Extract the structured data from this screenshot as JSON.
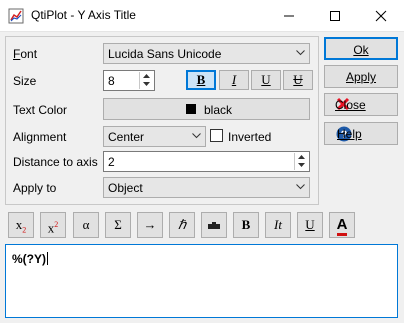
{
  "window": {
    "title": "QtiPlot - Y Axis Title",
    "controls": [
      "minimize-icon",
      "maximize-icon",
      "close-icon"
    ]
  },
  "form": {
    "font": {
      "label": "Font",
      "value": "Lucida Sans Unicode"
    },
    "size": {
      "label": "Size",
      "value": "8",
      "styles": [
        {
          "name": "bold",
          "glyph": "B",
          "active": true
        },
        {
          "name": "italic",
          "glyph": "I",
          "active": false
        },
        {
          "name": "underline",
          "glyph": "U",
          "active": false
        },
        {
          "name": "strikeout",
          "glyph": "U",
          "active": false
        }
      ]
    },
    "text_color": {
      "label": "Text Color",
      "value": "black",
      "swatch": "#000000"
    },
    "alignment": {
      "label": "Alignment",
      "value": "Center"
    },
    "inverted": {
      "label": "Inverted",
      "checked": false
    },
    "distance": {
      "label": "Distance to axis",
      "value": "2"
    },
    "apply_to": {
      "label": "Apply to",
      "value": "Object"
    }
  },
  "buttons": {
    "ok": "Ok",
    "apply": "Apply",
    "close": "Close",
    "help": "Help"
  },
  "toolbar": {
    "subscript": "x",
    "subscript_mark": "2",
    "superscript": "x",
    "superscript_mark": "2",
    "alpha": "α",
    "sigma": "Σ",
    "arrow": "→",
    "hbar": "ℏ",
    "bold": "B",
    "italic": "It",
    "underline": "U",
    "color": "A"
  },
  "editor": {
    "text": "%(?Y)"
  },
  "colors": {
    "accent": "#0078d7",
    "close_red": "#e81123",
    "help_blue": "#1e5aa8"
  }
}
